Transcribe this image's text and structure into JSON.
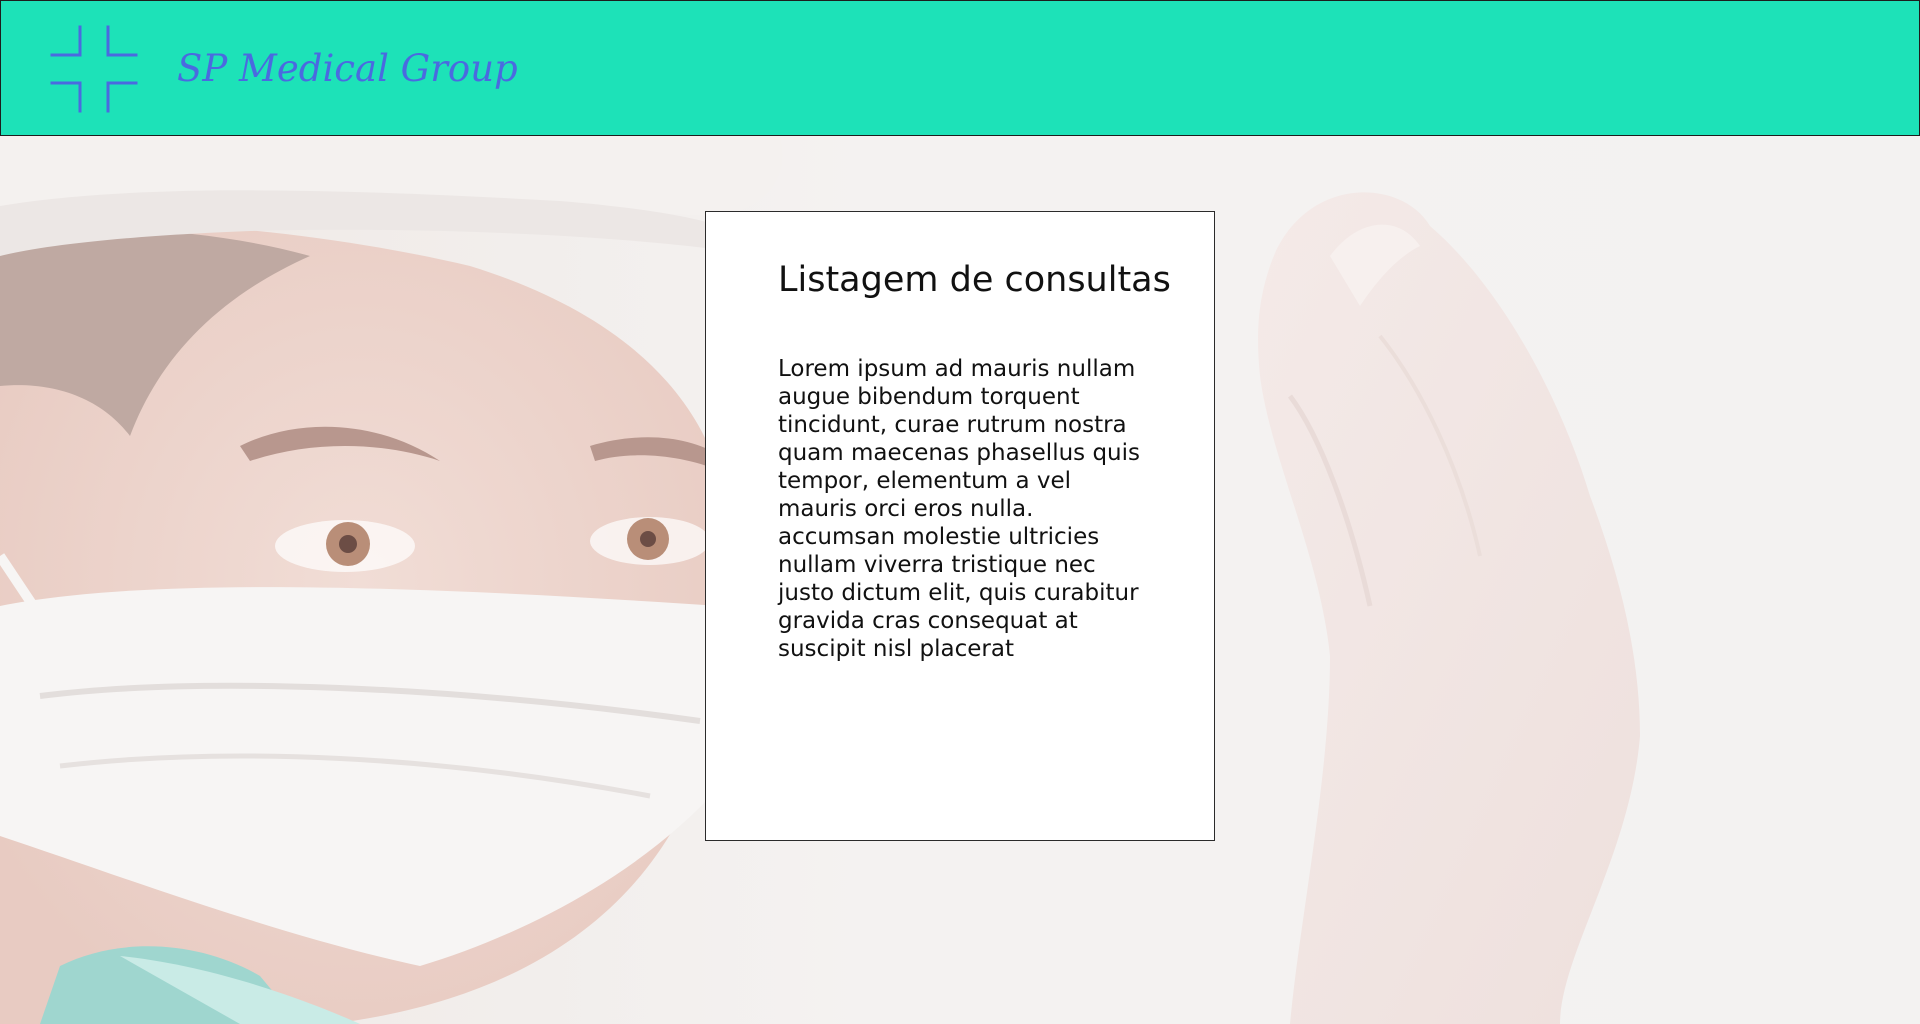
{
  "theme": {
    "header_bg": "#1de2b8",
    "accent": "#4a6ae0",
    "card_bg": "#ffffff",
    "text": "#111111"
  },
  "header": {
    "logo_icon": "medical-cross-corners-icon",
    "brand_name": "SP Medical Group"
  },
  "hero": {
    "image": "masked-surgeon-with-gloved-hand-photo"
  },
  "card": {
    "title": "Listagem de consultas",
    "body": "Lorem ipsum ad mauris nullam augue bibendum torquent tincidunt, curae rutrum nostra quam maecenas phasellus quis tempor, elementum a vel mauris orci eros nulla. accumsan molestie ultricies nullam viverra tristique nec justo dictum elit, quis curabitur gravida cras consequat at suscipit nisl placerat"
  }
}
